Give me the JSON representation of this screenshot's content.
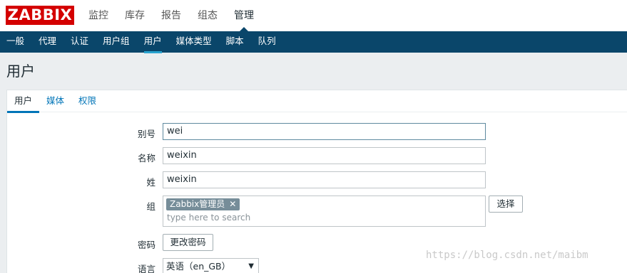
{
  "logo": {
    "text": "ZABBIX"
  },
  "main_menu": [
    {
      "label": "监控"
    },
    {
      "label": "库存"
    },
    {
      "label": "报告"
    },
    {
      "label": "组态"
    },
    {
      "label": "管理"
    }
  ],
  "sub_menu": [
    {
      "label": "一般"
    },
    {
      "label": "代理"
    },
    {
      "label": "认证"
    },
    {
      "label": "用户组"
    },
    {
      "label": "用户"
    },
    {
      "label": "媒体类型"
    },
    {
      "label": "脚本"
    },
    {
      "label": "队列"
    }
  ],
  "page_title": "用户",
  "tabs": [
    {
      "label": "用户"
    },
    {
      "label": "媒体"
    },
    {
      "label": "权限"
    }
  ],
  "form": {
    "alias": {
      "label": "别号",
      "value": "wei"
    },
    "name": {
      "label": "名称",
      "value": "weixin"
    },
    "surname": {
      "label": "姓",
      "value": "weixin"
    },
    "groups": {
      "label": "组",
      "chips": [
        {
          "text": "Zabbix管理员",
          "remove": "✕"
        }
      ],
      "placeholder": "type here to search",
      "select_button": "选择"
    },
    "password": {
      "label": "密码",
      "button": "更改密码"
    },
    "language": {
      "label": "语言",
      "selected": "英语（en_GB）",
      "arrow": "▼"
    }
  },
  "watermark": "https://blog.csdn.net/maibm",
  "colors": {
    "brand": "#d40000",
    "nav_bg": "#0a466a",
    "link": "#0275b8",
    "chip_bg": "#768d99"
  }
}
